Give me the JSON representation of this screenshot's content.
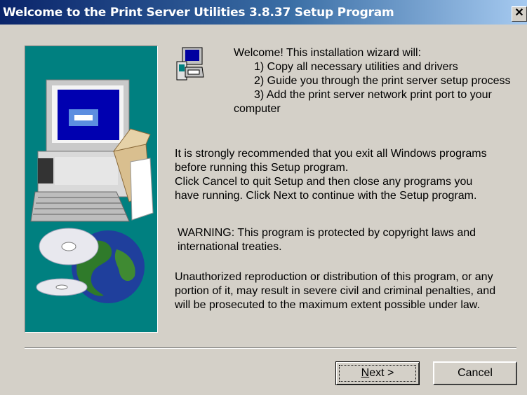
{
  "window": {
    "title": "Welcome to the Print Server Utilities 3.8.37 Setup Program",
    "close_glyph": "✕"
  },
  "welcome": {
    "intro": "Welcome! This installation wizard will:",
    "steps": [
      "1) Copy all necessary utilities and drivers",
      "2) Guide you through the print server setup process",
      "3) Add the print server network print port to your"
    ],
    "step3_cont": "computer"
  },
  "recommend": {
    "lines": [
      "It is strongly recommended that you exit all Windows programs",
      "before running this Setup program.",
      "Click Cancel to quit Setup and then close any programs you",
      "have running.  Click Next to continue with the Setup program."
    ]
  },
  "warning": {
    "lines": [
      "WARNING: This program is protected by copyright laws and",
      "international treaties."
    ]
  },
  "unauthorized": {
    "lines": [
      "Unauthorized reproduction or distribution of this program, or any",
      "portion of it, may result in severe civil and criminal penalties, and",
      "will be prosecuted to the maximum extent possible under law."
    ]
  },
  "buttons": {
    "next_mnemonic": "N",
    "next_rest": "ext >",
    "cancel": "Cancel"
  },
  "icons": {
    "side": "computer-globe-cd-illustration",
    "setup": "setup-computer-icon",
    "close": "close-icon"
  },
  "colors": {
    "title_start": "#0a246a",
    "title_end": "#a6caf0",
    "panel": "#008080",
    "face": "#d4d0c8"
  }
}
